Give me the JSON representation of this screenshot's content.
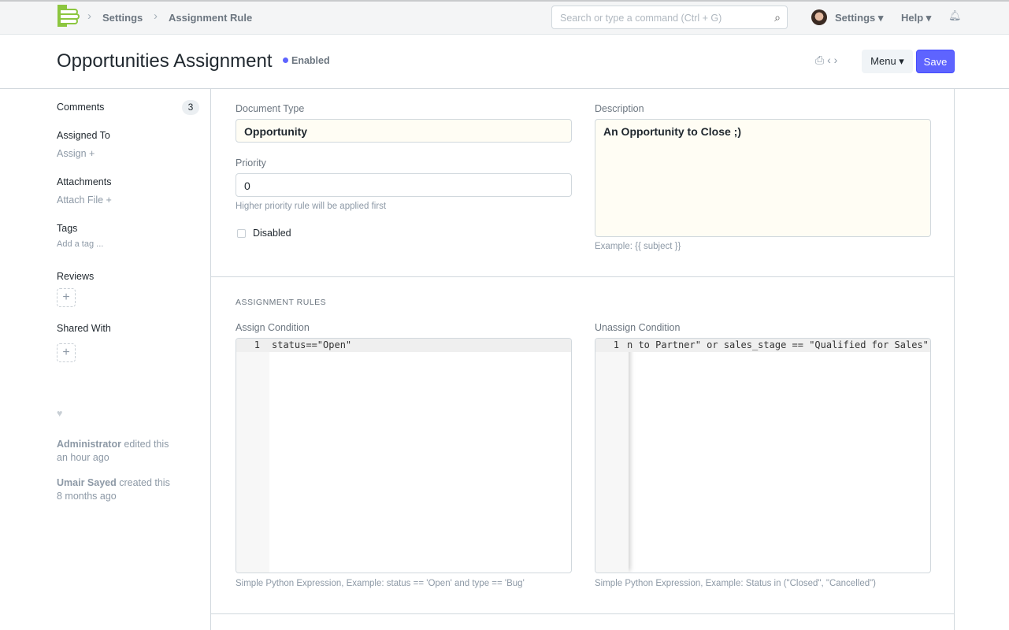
{
  "nav": {
    "breadcrumbs": [
      "Settings",
      "Assignment Rule"
    ],
    "search_placeholder": "Search or type a command (Ctrl + G)",
    "settings": "Settings",
    "help": "Help"
  },
  "header": {
    "title": "Opportunities Assignment",
    "status": "Enabled",
    "menu": "Menu",
    "save": "Save"
  },
  "sidebar": {
    "comments": "Comments",
    "comments_count": "3",
    "assigned_to": "Assigned To",
    "assign": "Assign +",
    "attachments": "Attachments",
    "attach_file": "Attach File +",
    "tags": "Tags",
    "add_tag": "Add a tag ...",
    "reviews": "Reviews",
    "shared_with": "Shared With",
    "activity": [
      {
        "user": "Administrator",
        "action": " edited this",
        "time": "an hour ago"
      },
      {
        "user": "Umair Sayed",
        "action": " created this",
        "time": "8 months ago"
      }
    ]
  },
  "form": {
    "document_type_label": "Document Type",
    "document_type": "Opportunity",
    "priority_label": "Priority",
    "priority": "0",
    "priority_help": "Higher priority rule will be applied first",
    "disabled_label": "Disabled",
    "description_label": "Description",
    "description": "An Opportunity to Close ;)",
    "description_help": "Example: {{ subject }}",
    "section": "ASSIGNMENT RULES",
    "assign_label": "Assign Condition",
    "assign_code": "status==\"Open\"",
    "assign_help": "Simple Python Expression, Example: status == 'Open' and type == 'Bug'",
    "unassign_label": "Unassign Condition",
    "unassign_code": "n to Partner\" or sales_stage == \"Qualified for Sales\"",
    "unassign_help": "Simple Python Expression, Example: Status in (\"Closed\", \"Cancelled\")",
    "line_number": "1"
  },
  "colors": {
    "accent": "#5e64ff",
    "logo": "#8cc63f",
    "input_bg": "#fffdf4"
  }
}
